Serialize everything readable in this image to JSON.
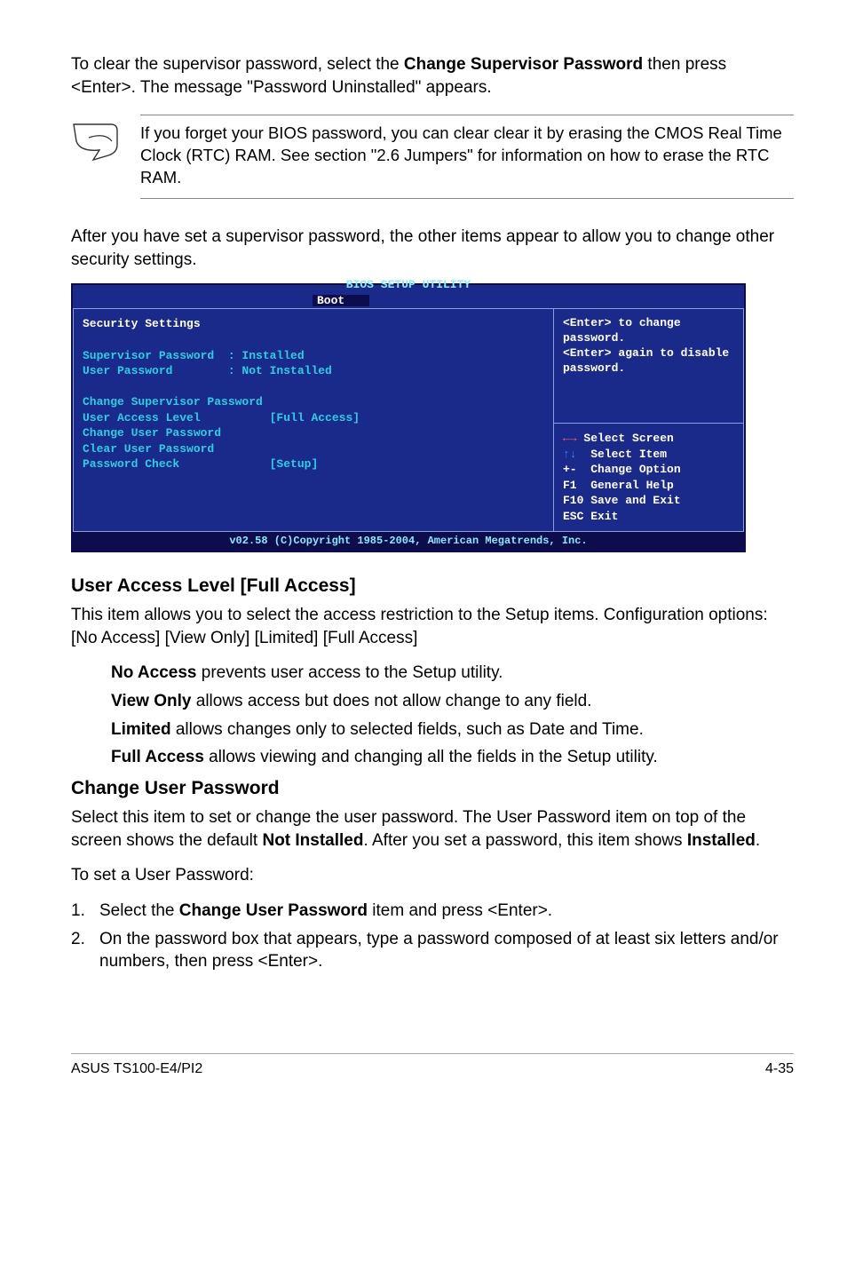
{
  "intro": {
    "p1_a": "To clear the supervisor password, select the ",
    "p1_bold": "Change Supervisor Password",
    "p1_b": " then press <Enter>. The message \"Password Uninstalled\" appears."
  },
  "note": {
    "text": "If you forget your BIOS password, you can clear clear it by erasing the CMOS Real Time Clock (RTC) RAM. See section \"2.6  Jumpers\" for information on how to erase the RTC RAM."
  },
  "after_note": "After you have set a supervisor password, the other items appear to allow you to change other security settings.",
  "bios": {
    "title": "BIOS SETUP UTILITY",
    "tab": "Boot",
    "left": "Security Settings\n\nSupervisor Password  : Installed\nUser Password        : Not Installed\n\nChange Supervisor Password\nUser Access Level          [Full Access]\nChange User Password\nClear User Password\nPassword Check             [Setup]",
    "right_top": "<Enter> to change password.\n<Enter> again to disable password.",
    "right_bot": "   Select Screen\n   Select Item\n+-  Change Option\nF1  General Help\nF10 Save and Exit\nESC Exit",
    "footer": "v02.58 (C)Copyright 1985-2004, American Megatrends, Inc."
  },
  "sect1": {
    "heading": "User Access Level [Full Access]",
    "desc": "This item allows you to select the access restriction to the Setup items. Configuration options: [No Access] [View Only] [Limited] [Full Access]",
    "bullets": [
      {
        "bold": "No Access",
        "rest": " prevents user access to the Setup utility."
      },
      {
        "bold": "View Only",
        "rest": " allows access but does not allow change to any field."
      },
      {
        "bold": "Limited",
        "rest": " allows changes only to selected fields, such as Date and Time."
      },
      {
        "bold": "Full Access",
        "rest": " allows viewing and changing all the fields in the Setup utility."
      }
    ]
  },
  "sect2": {
    "heading": "Change User Password",
    "p1_a": "Select this item to set or change the user password. The User Password item on top of the screen shows the default ",
    "p1_bold1": "Not Installed",
    "p1_b": ". After you set a password, this item shows ",
    "p1_bold2": "Installed",
    "p1_c": ".",
    "p2": "To set a User Password:",
    "li1_a": "Select the ",
    "li1_bold": "Change User Password",
    "li1_b": " item and press <Enter>.",
    "li2": "On the password box that appears, type a password composed of at least six letters and/or numbers, then press <Enter>."
  },
  "footer": {
    "left": "ASUS TS100-E4/PI2",
    "right": "4-35"
  }
}
